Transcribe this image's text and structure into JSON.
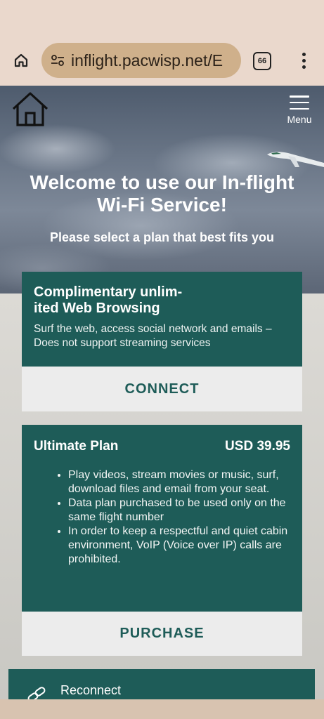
{
  "browser": {
    "url": "inflight.pacwisp.net/E",
    "tab_count": "66"
  },
  "header": {
    "menu_label": "Menu"
  },
  "hero": {
    "title": "Welcome to use our In-flight Wi-Fi Service!",
    "subtitle": "Please select a plan that best fits you"
  },
  "free_plan": {
    "title": "Complimentary unlim- ited Web Browsing",
    "description": "Surf the web, access social network and emails –Does not support streaming services",
    "button_label": "CONNECT"
  },
  "ultimate_plan": {
    "title": "Ultimate Plan",
    "price": "USD 39.95",
    "features": [
      "Play videos, stream movies or music, surf, download files and email from your seat.",
      "Data plan purchased to be used only on the same flight number",
      "In order to keep a respectful and quiet cabin environment, VoIP (Voice over IP) calls are prohibited."
    ],
    "button_label": "PURCHASE"
  },
  "reconnect": {
    "label": "Reconnect"
  },
  "colors": {
    "brand_teal": "#1e5c58",
    "button_bg": "#ececec",
    "urlbar_bg": "#cfb08b"
  },
  "icons": {
    "browser_home": "home-icon",
    "site_tune": "tune-icon",
    "site_home": "house-icon",
    "menu": "hamburger-icon",
    "reconnect": "link-icon",
    "more": "more-vert-icon"
  }
}
